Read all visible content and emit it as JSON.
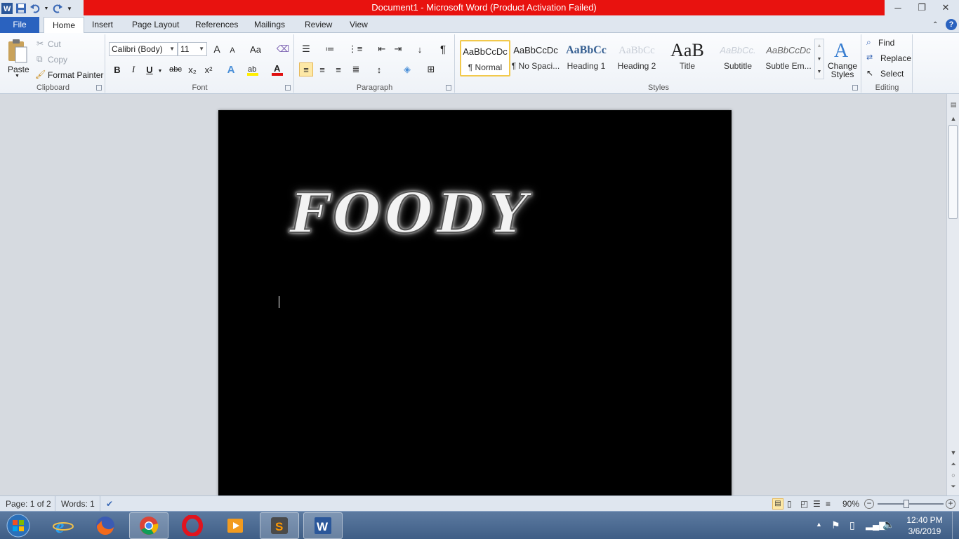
{
  "window": {
    "title": "Document1  -  Microsoft Word (Product Activation Failed)",
    "minimize": "─",
    "restore": "❐",
    "close": "✕"
  },
  "tabs": [
    "File",
    "Home",
    "Insert",
    "Page Layout",
    "References",
    "Mailings",
    "Review",
    "View"
  ],
  "active_tab": "Home",
  "clipboard": {
    "paste": "Paste",
    "cut": "Cut",
    "copy": "Copy",
    "format_painter": "Format Painter",
    "label": "Clipboard"
  },
  "font": {
    "name": "Calibri (Body)",
    "size": "11",
    "label": "Font",
    "bold": "B",
    "italic": "I",
    "underline": "U",
    "strike": "abc",
    "subscript": "x₂",
    "superscript": "x²",
    "grow": "A",
    "shrink": "A",
    "change_case": "Aa"
  },
  "paragraph": {
    "label": "Paragraph",
    "pilcrow": "¶"
  },
  "styles": {
    "label": "Styles",
    "items": [
      {
        "sample": "AaBbCcDc",
        "name": "¶ Normal",
        "selected": true
      },
      {
        "sample": "AaBbCcDc",
        "name": "¶ No Spaci..."
      },
      {
        "sample": "AaBbCc",
        "name": "Heading 1"
      },
      {
        "sample": "AaBbCc",
        "name": "Heading 2"
      },
      {
        "sample": "AaB",
        "name": "Title"
      },
      {
        "sample": "AaBbCc.",
        "name": "Subtitle"
      },
      {
        "sample": "AaBbCcDc",
        "name": "Subtle Em..."
      }
    ],
    "change_styles": "Change Styles"
  },
  "editing": {
    "label": "Editing",
    "find": "Find",
    "replace": "Replace",
    "select": "Select"
  },
  "document": {
    "wordart": "FOODY",
    "page_color": "#000000"
  },
  "statusbar": {
    "page": "Page: 1 of 2",
    "words": "Words: 1",
    "zoom": "90%",
    "zoom_out": "−",
    "zoom_in": "+"
  },
  "taskbar": {
    "time": "12:40 PM",
    "date": "3/6/2019"
  },
  "colors": {
    "title_warning": "#e8120f",
    "file_tab": "#2a62bf"
  }
}
